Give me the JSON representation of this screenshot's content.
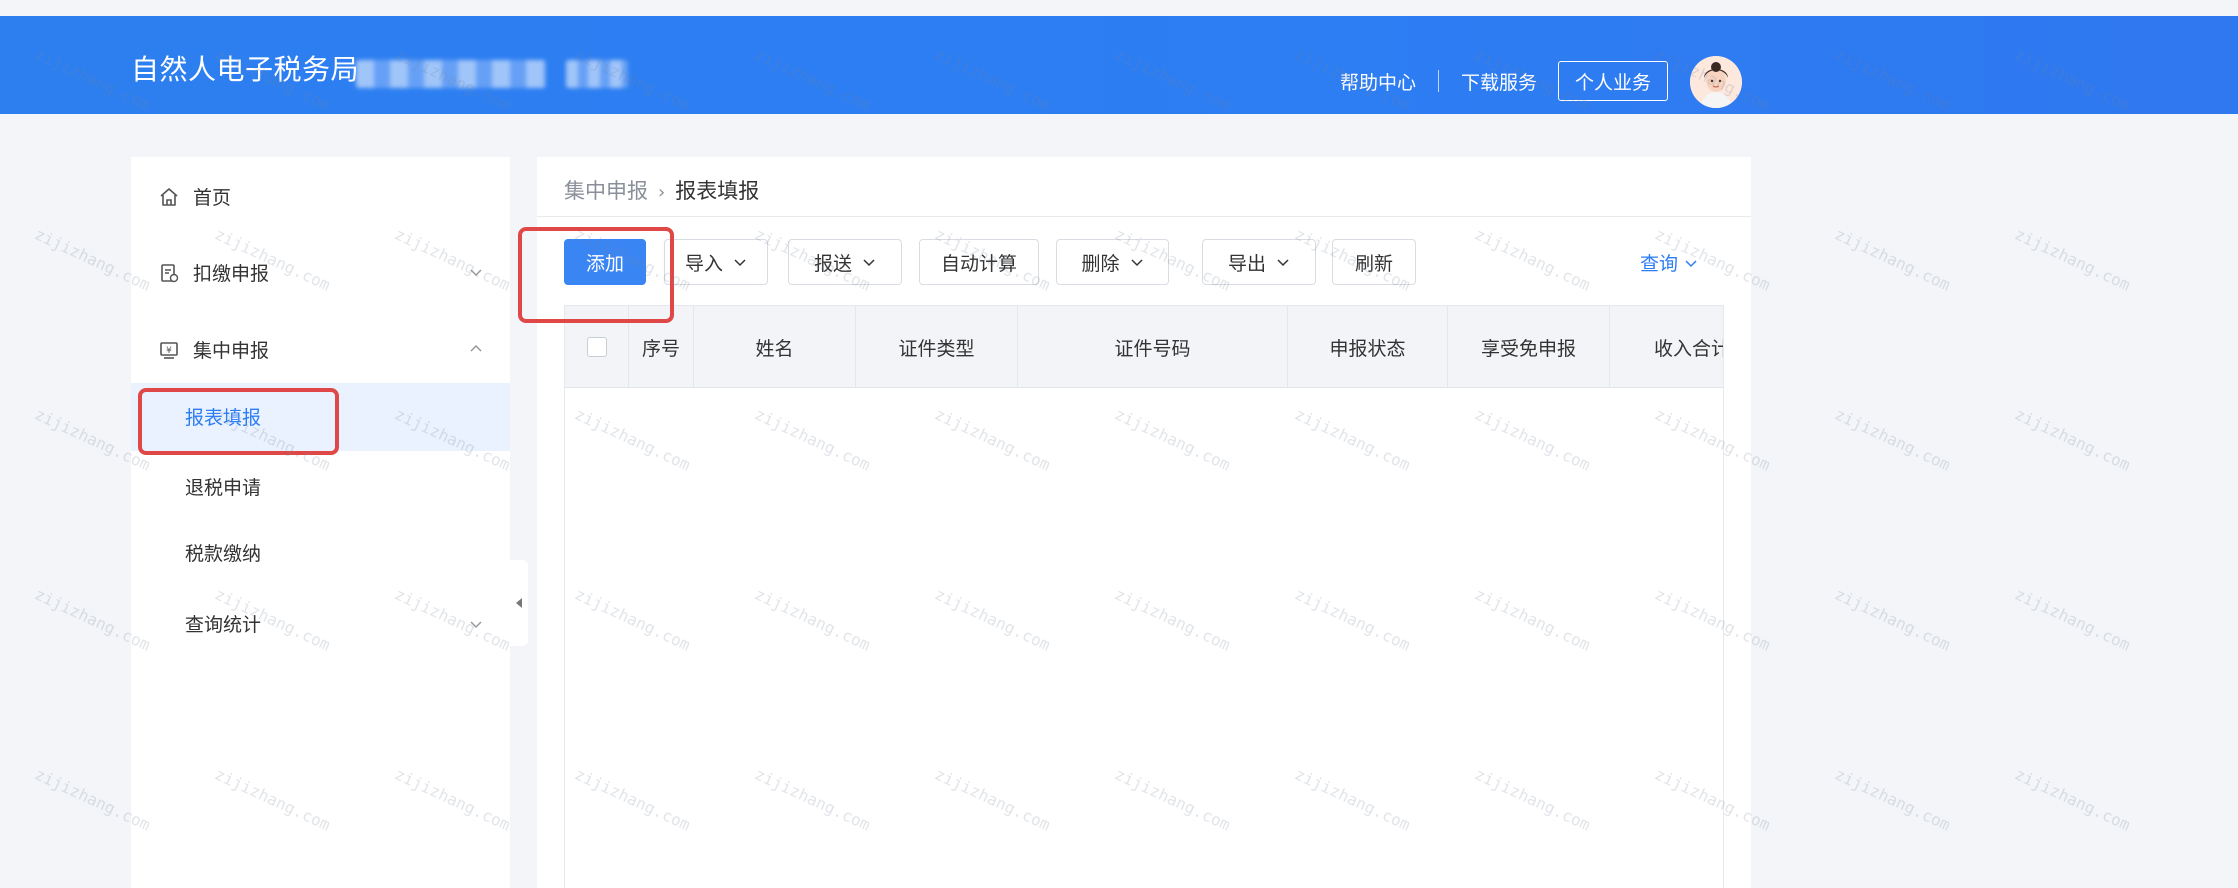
{
  "header": {
    "app_title": "自然人电子税务局",
    "links": [
      "帮助中心",
      "下载服务"
    ],
    "personal_button": "个人业务"
  },
  "sidebar": {
    "items": [
      {
        "label": "首页",
        "icon": "home-icon"
      },
      {
        "label": "扣缴申报",
        "icon": "withholding-doc-icon",
        "expanded": false
      },
      {
        "label": "集中申报",
        "icon": "yuan-screen-icon",
        "expanded": true
      }
    ],
    "subitems": [
      {
        "label": "报表填报",
        "active": true
      },
      {
        "label": "退税申请",
        "active": false
      },
      {
        "label": "税款缴纳",
        "active": false
      },
      {
        "label": "查询统计",
        "active": false,
        "has_children": true
      }
    ]
  },
  "breadcrumb": {
    "parent": "集中申报",
    "current": "报表填报"
  },
  "toolbar": {
    "add": "添加",
    "import": "导入",
    "submit": "报送",
    "auto_calc": "自动计算",
    "delete": "删除",
    "export": "导出",
    "refresh": "刷新",
    "query": "查询"
  },
  "table": {
    "columns": [
      "序号",
      "姓名",
      "证件类型",
      "证件号码",
      "申报状态",
      "享受免申报",
      "收入合计"
    ]
  },
  "watermark": "zijizhang.com",
  "colors": {
    "header_blue": "#2d7ff0",
    "accent": "#2e7df3",
    "highlight_red": "#e04848"
  }
}
